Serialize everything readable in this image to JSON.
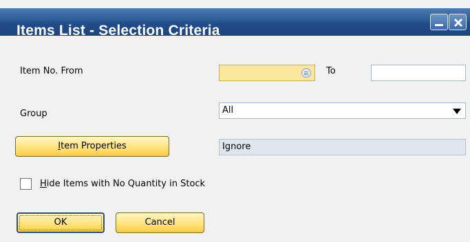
{
  "window": {
    "title": "Items List - Selection Criteria",
    "minimize_icon": "minimize-icon",
    "close_icon": "close-icon"
  },
  "form": {
    "item_no_from": {
      "label": "Item No. From",
      "value": ""
    },
    "to": {
      "label": "To",
      "value": ""
    },
    "group": {
      "label": "Group",
      "value": "All"
    },
    "item_properties": {
      "button_label_first": "I",
      "button_label_rest": "tem Properties",
      "value": "Ignore"
    },
    "hide_items": {
      "label_first": "H",
      "label_rest": "ide Items with No Quantity in Stock",
      "checked": false
    }
  },
  "buttons": {
    "ok": "OK",
    "cancel": "Cancel"
  },
  "colors": {
    "title_bar": "#2b5994",
    "button_yellow": "#ffe37e",
    "field_yellow": "#fbe69e"
  }
}
